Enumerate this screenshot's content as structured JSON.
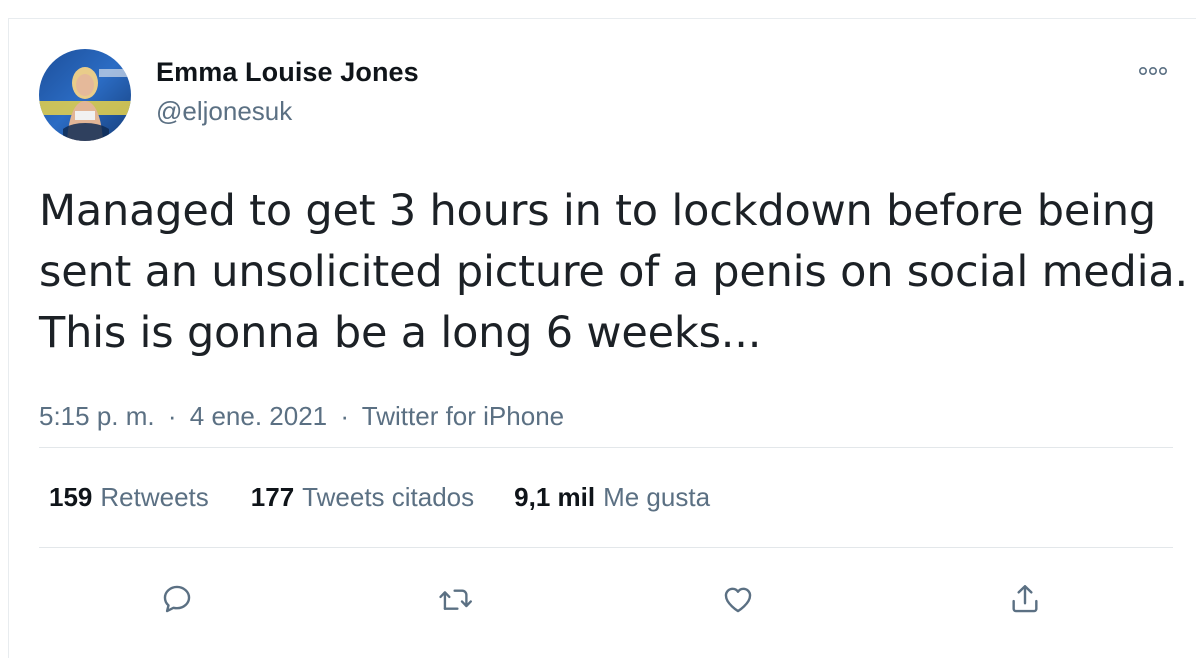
{
  "tweet": {
    "author": {
      "display_name": "Emma Louise Jones",
      "handle": "@eljonesuk"
    },
    "text_lines": [
      "Managed to get 3 hours in to lockdown before being",
      "sent an unsolicited picture of a penis on social media.",
      "This is gonna be a long 6 weeks..."
    ],
    "time": "5:15 p. m.",
    "separator": "·",
    "date": "4 ene. 2021",
    "source": "Twitter for iPhone"
  },
  "stats": {
    "retweets": {
      "count": "159",
      "label": "Retweets"
    },
    "quotes": {
      "count": "177",
      "label": "Tweets citados"
    },
    "likes": {
      "count": "9,1 mil",
      "label": "Me gusta"
    }
  },
  "icons": {
    "more": "more-icon",
    "reply": "reply-icon",
    "retweet": "retweet-icon",
    "like": "heart-icon",
    "share": "share-icon"
  },
  "colors": {
    "text_primary": "#0f1419",
    "text_secondary": "#5b7083",
    "divider": "#e3e7ea",
    "icon": "#5b7083"
  }
}
